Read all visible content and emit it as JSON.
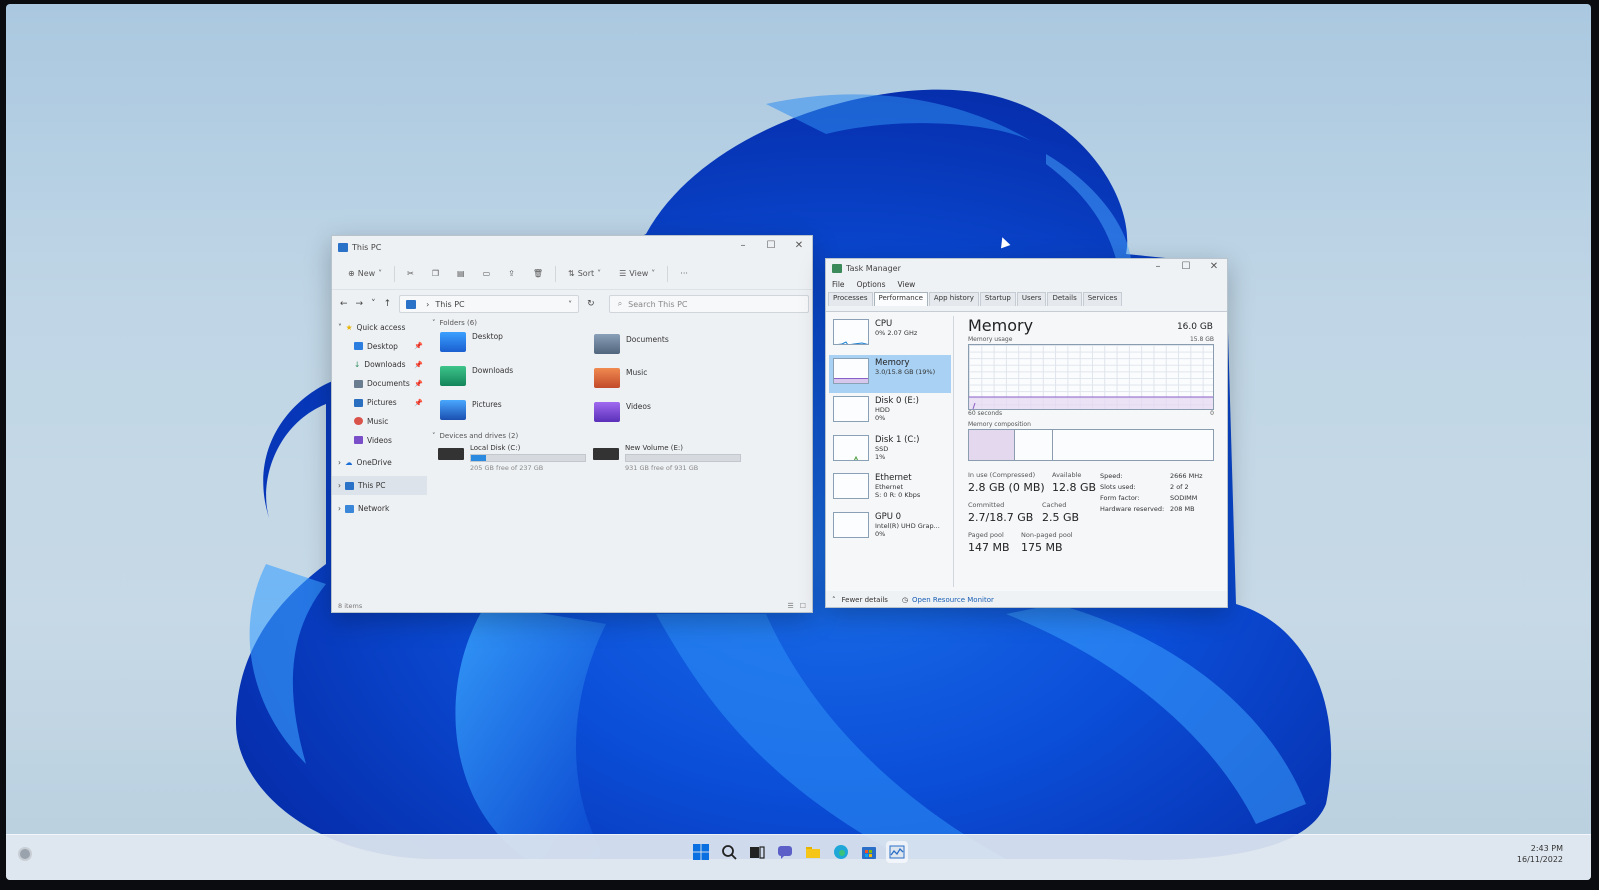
{
  "colors": {
    "accent": "#0a5fd6",
    "bloom_light": "#2a8cf0",
    "bloom_dark": "#0636b8",
    "selection": "#a9d1f3"
  },
  "explorer": {
    "title": "This PC",
    "toolbar": {
      "new": "New",
      "sort": "Sort",
      "view": "View",
      "more": "···"
    },
    "address": "This PC",
    "search_placeholder": "Search This PC",
    "nav": {
      "quick_access": "Quick access",
      "desktop": "Desktop",
      "downloads": "Downloads",
      "documents": "Documents",
      "pictures": "Pictures",
      "music": "Music",
      "videos": "Videos",
      "onedrive": "OneDrive",
      "this_pc": "This PC",
      "network": "Network"
    },
    "folders_header": "Folders (6)",
    "folders": {
      "desktop": "Desktop",
      "documents": "Documents",
      "downloads": "Downloads",
      "music": "Music",
      "pictures": "Pictures",
      "videos": "Videos"
    },
    "drives_header": "Devices and drives (2)",
    "drives": [
      {
        "name": "Local Disk (C:)",
        "free": "205 GB free of 237 GB",
        "used_fraction": 0.135
      },
      {
        "name": "New Volume (E:)",
        "free": "931 GB free of 931 GB",
        "used_fraction": 0.0
      }
    ],
    "status": "8 items"
  },
  "taskmgr": {
    "title": "Task Manager",
    "menu": {
      "file": "File",
      "options": "Options",
      "view": "View"
    },
    "tabs": [
      "Processes",
      "Performance",
      "App history",
      "Startup",
      "Users",
      "Details",
      "Services"
    ],
    "resources": [
      {
        "name": "CPU",
        "sub1": "0% 2.07 GHz",
        "sub2": "",
        "sub3": ""
      },
      {
        "name": "Memory",
        "sub1": "3.0/15.8 GB (19%)",
        "sub2": "",
        "sub3": ""
      },
      {
        "name": "Disk 0 (E:)",
        "sub1": "HDD",
        "sub2": "0%",
        "sub3": ""
      },
      {
        "name": "Disk 1 (C:)",
        "sub1": "SSD",
        "sub2": "1%",
        "sub3": ""
      },
      {
        "name": "Ethernet",
        "sub1": "Ethernet",
        "sub2": "S: 0 R: 0 Kbps",
        "sub3": ""
      },
      {
        "name": "GPU 0",
        "sub1": "Intel(R) UHD Grap...",
        "sub2": "0%",
        "sub3": ""
      }
    ],
    "memory": {
      "title": "Memory",
      "total": "16.0 GB",
      "usage_label": "Memory usage",
      "usage_max": "15.8 GB",
      "time_label": "60 seconds",
      "zero": "0",
      "composition_label": "Memory composition",
      "in_use_label": "In use (Compressed)",
      "in_use": "2.8 GB (0 MB)",
      "available_label": "Available",
      "available": "12.8 GB",
      "committed_label": "Committed",
      "committed": "2.7/18.7 GB",
      "cached_label": "Cached",
      "cached": "2.5 GB",
      "paged_label": "Paged pool",
      "paged": "147 MB",
      "nonpaged_label": "Non-paged pool",
      "nonpaged": "175 MB",
      "speed_label": "Speed:",
      "speed": "2666 MHz",
      "slots_label": "Slots used:",
      "slots": "2 of 2",
      "form_label": "Form factor:",
      "form": "SODIMM",
      "reserved_label": "Hardware reserved:",
      "reserved": "208 MB"
    },
    "footer": {
      "fewer": "Fewer details",
      "resmon": "Open Resource Monitor"
    }
  },
  "taskbar": {
    "time": "2:43 PM",
    "date": "16/11/2022"
  }
}
